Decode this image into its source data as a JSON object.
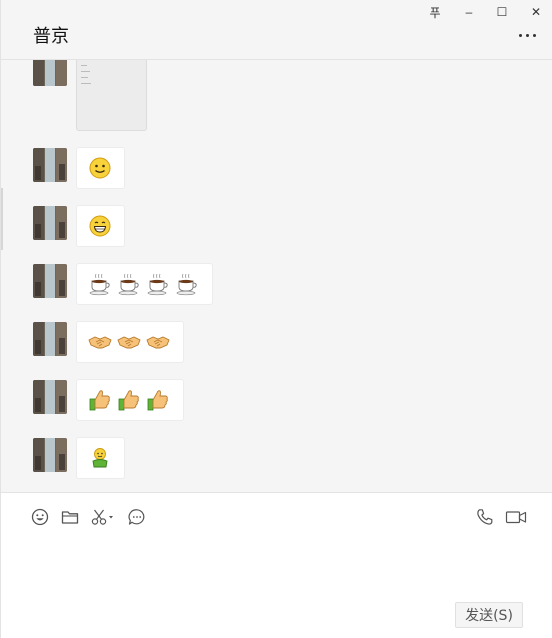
{
  "window": {
    "title": "普京",
    "pin_glyph": "푸",
    "minimize_glyph": "–",
    "maximize_glyph": "☐",
    "close_glyph": "✕"
  },
  "messages": [
    {
      "type": "file-preview",
      "avatar": "street-photo-avatar"
    },
    {
      "type": "emoji",
      "emojis": [
        "smile-emoji"
      ]
    },
    {
      "type": "emoji",
      "emojis": [
        "grin-emoji"
      ]
    },
    {
      "type": "emoji",
      "emojis": [
        "coffee-emoji",
        "coffee-emoji",
        "coffee-emoji",
        "coffee-emoji"
      ]
    },
    {
      "type": "emoji",
      "emojis": [
        "handshake-emoji",
        "handshake-emoji",
        "handshake-emoji"
      ]
    },
    {
      "type": "emoji",
      "emojis": [
        "thumbs-up-emoji",
        "thumbs-up-emoji",
        "thumbs-up-emoji"
      ]
    },
    {
      "type": "emoji",
      "emojis": [
        "little-person-emoji"
      ]
    }
  ],
  "toolbar": {
    "icons": [
      "emoji-icon",
      "folder-icon",
      "scissors-icon",
      "chat-history-icon",
      "phone-icon",
      "video-icon"
    ]
  },
  "composer": {
    "send_label": "发送(S)"
  },
  "colors": {
    "background": "#f5f5f5",
    "bubble": "#ffffff",
    "border": "#e3e3e3"
  }
}
